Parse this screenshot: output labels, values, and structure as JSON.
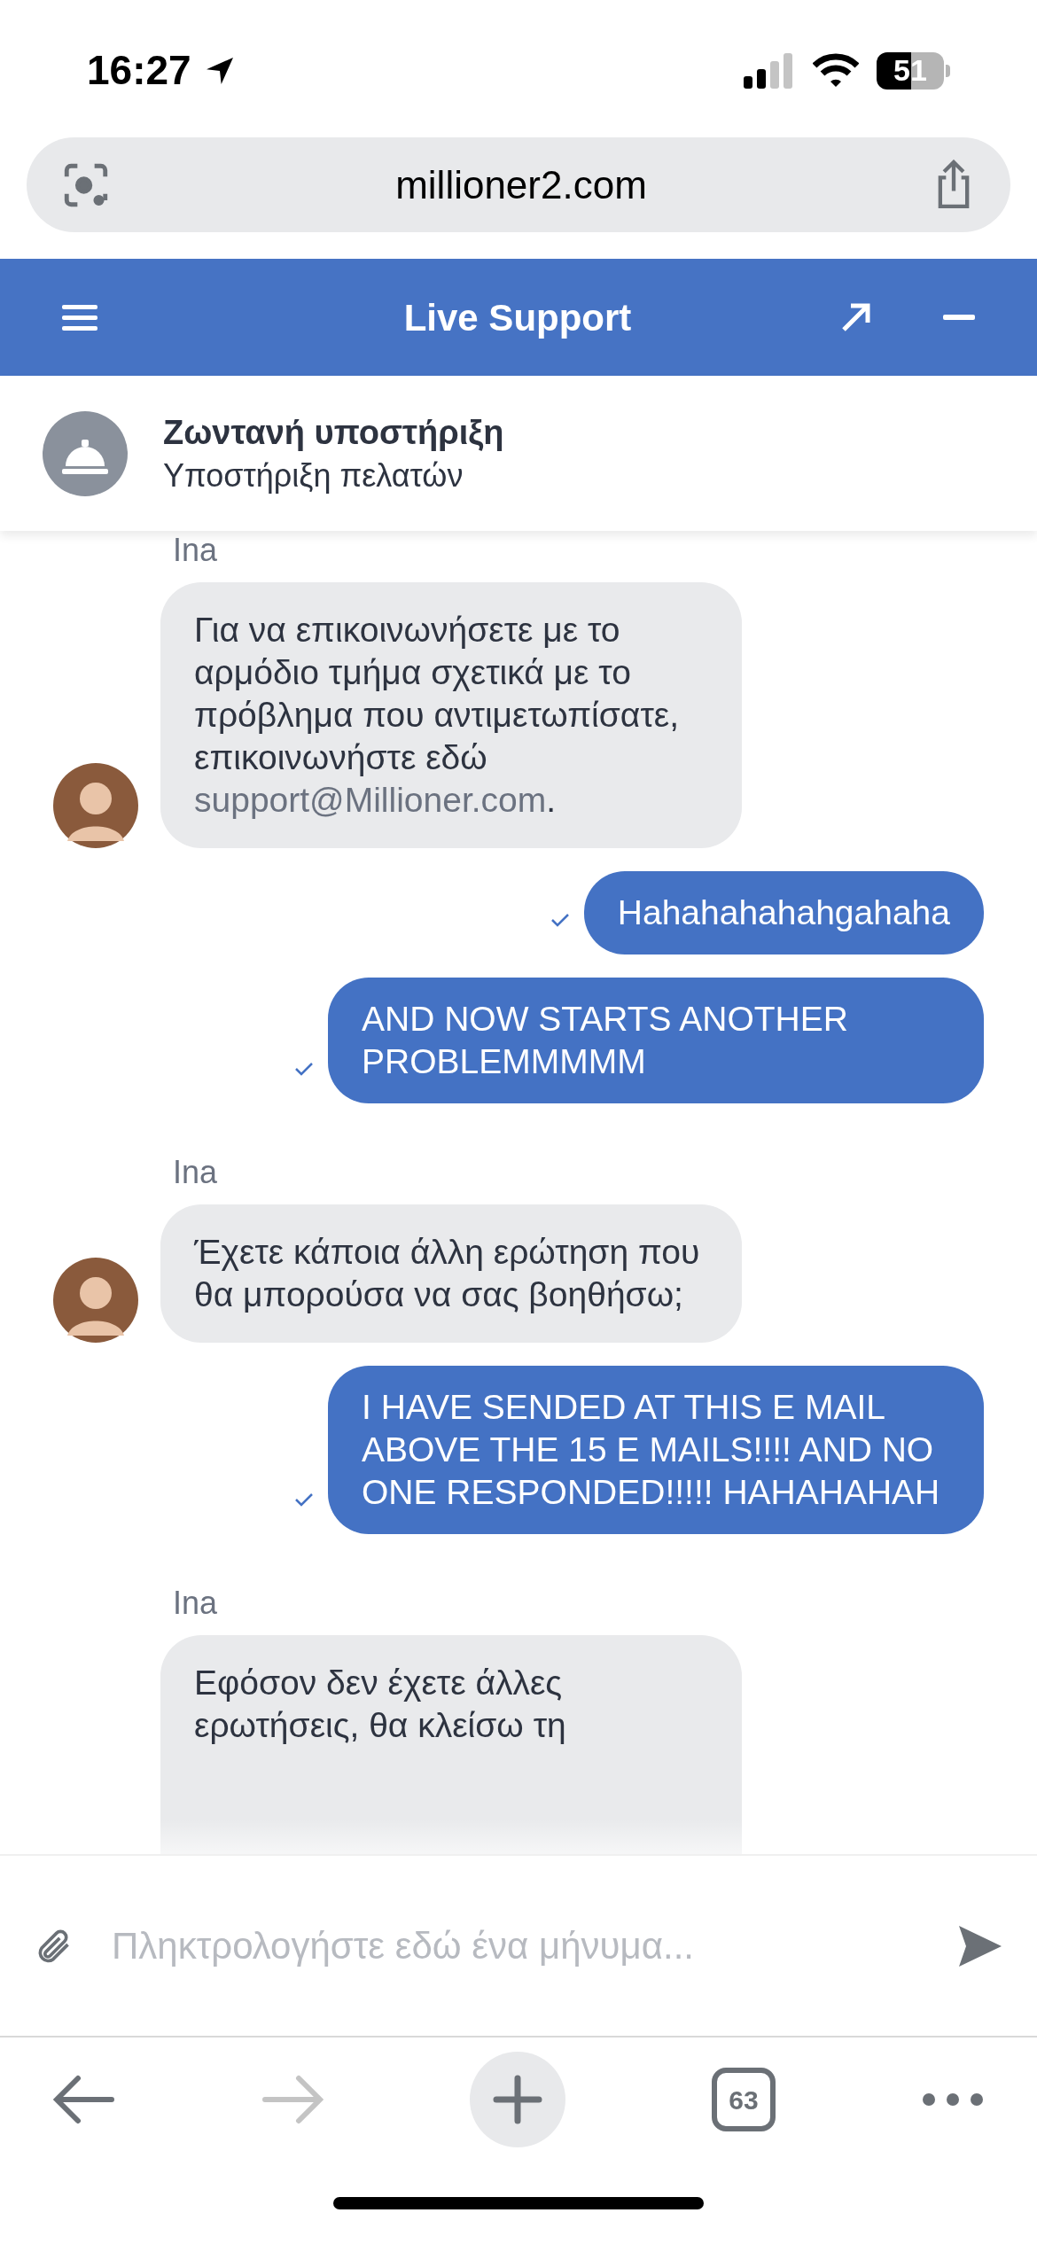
{
  "status_bar": {
    "time": "16:27",
    "battery": "51"
  },
  "address_bar": {
    "url": "millioner2.com"
  },
  "chat_header": {
    "title": "Live Support"
  },
  "agent": {
    "title": "Ζωντανή υποστήριξη",
    "subtitle": "Υποστήριξη πελατών"
  },
  "messages": [
    {
      "kind": "received",
      "sender": "Ina",
      "text": "Για να επικοινωνήσετε με το αρμόδιο τμήμα σχετικά με το πρόβλημα που αντιμετωπίσατε, επικοινωνήστε εδώ",
      "link": "support@Millioner.com",
      "suffix": "."
    },
    {
      "kind": "sent",
      "text": "Hahahahahahgahaha",
      "delivered": true
    },
    {
      "kind": "sent",
      "text": "AND NOW STARTS ANOTHER PROBLEMMMMM",
      "delivered": true
    },
    {
      "kind": "received",
      "sender": "Ina",
      "text": "Έχετε κάποια άλλη ερώτηση που θα μπορούσα να σας βοηθήσω;"
    },
    {
      "kind": "sent",
      "text": "I HAVE SENDED AT THIS E MAIL ABOVE THE 15 E MAILS!!!! AND NO ONE RESPONDED!!!!! HAHAHAHAH",
      "delivered": true
    },
    {
      "kind": "received",
      "sender": "Ina",
      "text": "Εφόσον δεν έχετε άλλες ερωτήσεις, θα κλείσω τη",
      "cut": true
    }
  ],
  "composer": {
    "placeholder": "Πληκτρολογήστε εδώ ένα μήνυμα..."
  },
  "browser_toolbar": {
    "tab_count": "63",
    "forward_disabled": true
  }
}
